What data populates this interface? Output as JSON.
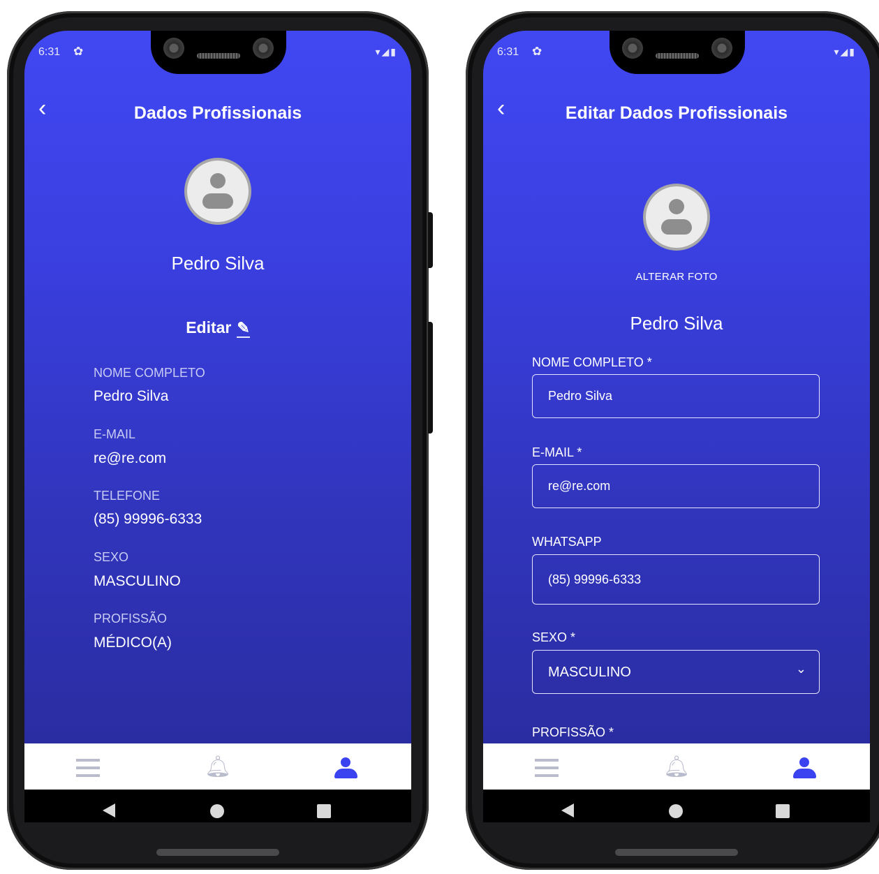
{
  "status_bar": {
    "time": "6:31",
    "settings_icon": "gear-icon",
    "signal_icons": "▾◢▮"
  },
  "view_screen": {
    "title": "Dados Profissionais",
    "back_icon": "back-chevron-icon",
    "name": "Pedro Silva",
    "edit_label": "Editar",
    "edit_icon": "pencil-icon",
    "fields": [
      {
        "label": "NOME COMPLETO",
        "value": "Pedro Silva"
      },
      {
        "label": "E-MAIL",
        "value": "re@re.com"
      },
      {
        "label": "TELEFONE",
        "value": "(85) 99996-6333"
      },
      {
        "label": "SEXO",
        "value": "MASCULINO"
      },
      {
        "label": "PROFISSÃO",
        "value": "MÉDICO(A)"
      }
    ]
  },
  "edit_screen": {
    "title": "Editar Dados Profissionais",
    "alter_photo_label": "ALTERAR FOTO",
    "name": "Pedro Silva",
    "fields": {
      "nome": {
        "label": "NOME COMPLETO *",
        "value": "Pedro Silva"
      },
      "email": {
        "label": "E-MAIL *",
        "value": "re@re.com"
      },
      "whatsapp": {
        "label": "WHATSAPP",
        "value": "(85) 99996-6333"
      },
      "sexo": {
        "label": "SEXO *",
        "value": "MASCULINO"
      },
      "profissao": {
        "label": "PROFISSÃO *"
      }
    }
  },
  "tab_bar": {
    "items": [
      {
        "icon": "menu-icon",
        "active": false
      },
      {
        "icon": "bell-icon",
        "active": false
      },
      {
        "icon": "user-icon",
        "active": true
      }
    ],
    "active_color": "#3b43f0",
    "inactive_color": "#b9bccc"
  },
  "nav_bar": {
    "icons": [
      "back-triangle-icon",
      "home-circle-icon",
      "recents-square-icon"
    ]
  },
  "colors": {
    "gradient_top": "#4148f2",
    "gradient_bottom": "#282a98"
  }
}
